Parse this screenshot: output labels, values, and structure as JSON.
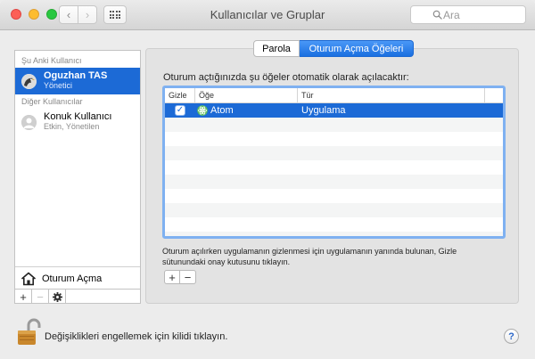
{
  "window": {
    "title": "Kullanıcılar ve Gruplar"
  },
  "toolbar": {
    "back_label": "‹",
    "forward_label": "›",
    "search_placeholder": "Ara"
  },
  "sidebar": {
    "current_header": "Şu Anki Kullanıcı",
    "current_user": {
      "name": "Oguzhan TAS",
      "role": "Yönetici"
    },
    "other_header": "Diğer Kullanıcılar",
    "other_users": [
      {
        "name": "Konuk Kullanıcı",
        "role": "Etkin, Yönetilen"
      }
    ],
    "login_options_label": "Oturum Açma",
    "add_label": "+",
    "remove_label": "−"
  },
  "tabs": [
    {
      "label": "Parola",
      "selected": false
    },
    {
      "label": "Oturum Açma Öğeleri",
      "selected": true
    }
  ],
  "login_items": {
    "heading": "Oturum açtığınızda şu öğeler otomatik olarak açılacaktır:",
    "columns": [
      "Gizle",
      "Öğe",
      "Tür"
    ],
    "rows": [
      {
        "hide": true,
        "checkmark": "✓",
        "item": "Atom",
        "kind": "Uygulama"
      }
    ],
    "note": "Oturum açılırken uygulamanın gizlenmesi için uygulamanın yanında bulunan, Gizle sütunundaki onay kutusunu tıklayın.",
    "add_label": "+",
    "remove_label": "−"
  },
  "footer": {
    "lock_text": "Değişiklikleri engellemek için kilidi tıklayın.",
    "help_label": "?"
  },
  "colors": {
    "accent": "#1c6ad6",
    "close": "#fc5f57",
    "minimize": "#fdbc2e",
    "maximize": "#28c840"
  }
}
